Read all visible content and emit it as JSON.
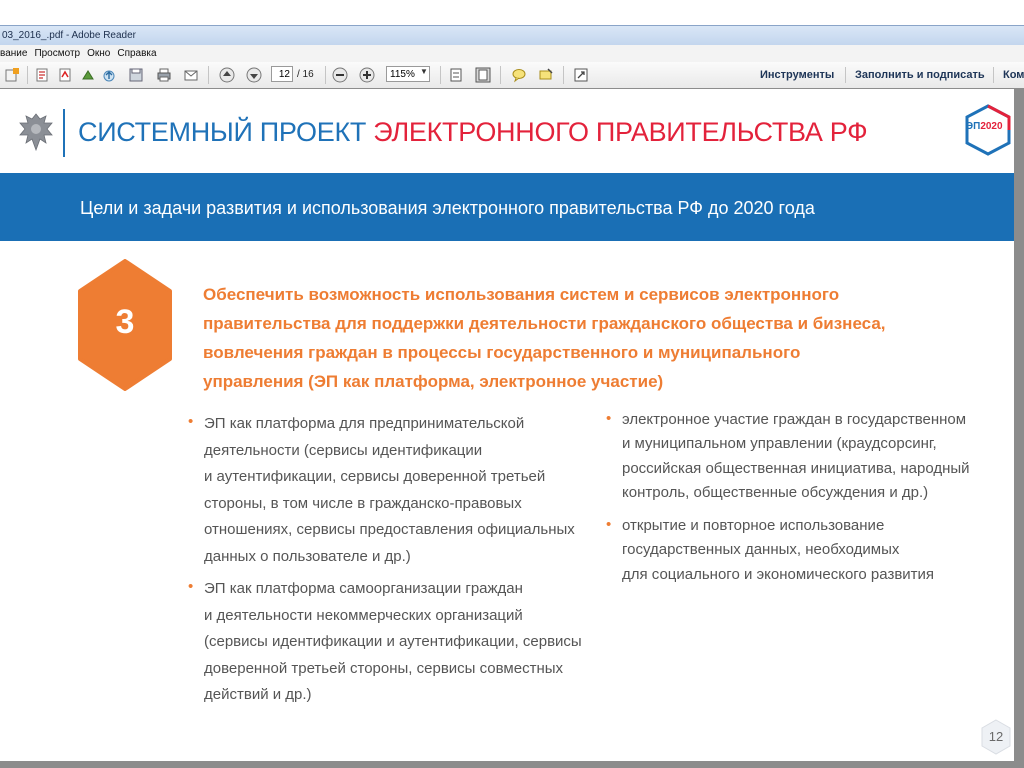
{
  "window": {
    "title": "03_2016_.pdf - Adobe Reader"
  },
  "menu": {
    "items": [
      "вание",
      "Просмотр",
      "Окно",
      "Справка"
    ]
  },
  "toolbar": {
    "current_page": "12",
    "total_pages": "/ 16",
    "zoom": "115%",
    "tools_label": "Инструменты",
    "fill_sign_label": "Заполнить и подписать",
    "comment_label": "Ком"
  },
  "slide": {
    "title_part1": "СИСТЕМНЫЙ ПРОЕКТ",
    "title_part2": "ЭЛЕКТРОННОГО ПРАВИТЕЛЬСТВА РФ",
    "logo_ep": "ЭП",
    "logo_year": "2020",
    "banner": "Цели и задачи развития и использования электронного правительства РФ до 2020 года",
    "goal_number": "3",
    "headline": [
      "Обеспечить возможность использования систем и сервисов электронного",
      "правительства для поддержки деятельности гражданского общества и бизнеса,",
      "вовлечения граждан в процессы государственного и муниципального",
      "управления (ЭП как платформа, электронное участие)"
    ],
    "left_bullets": [
      {
        "lines": [
          "ЭП как платформа для предпринимательской",
          "деятельности (сервисы идентификации",
          "и аутентификации, сервисы доверенной третьей",
          "стороны, в том числе в гражданско-правовых",
          "отношениях, сервисы предоставления официальных",
          "данных о пользователе и др.)"
        ]
      },
      {
        "lines": [
          "ЭП как платформа самоорганизации граждан",
          "и деятельности некоммерческих организаций",
          "(сервисы идентификации и аутентификации, сервисы",
          "доверенной третьей стороны, сервисы совместных",
          "действий и др.)"
        ]
      }
    ],
    "right_bullets": [
      {
        "lines": [
          "электронное участие граждан в государственном",
          "и муниципальном управлении (краудсорсинг,",
          "российская общественная инициатива, народный",
          "контроль, общественные обсуждения и др.)"
        ]
      },
      {
        "lines": [
          "открытие и повторное использование",
          "государственных данных, необходимых",
          "для социального и экономического развития"
        ]
      }
    ],
    "page_number": "12"
  },
  "colors": {
    "brand_blue": "#1f72b8",
    "brand_red": "#e3223b",
    "accent_orange": "#ee7d33",
    "body_gray": "#555555"
  }
}
